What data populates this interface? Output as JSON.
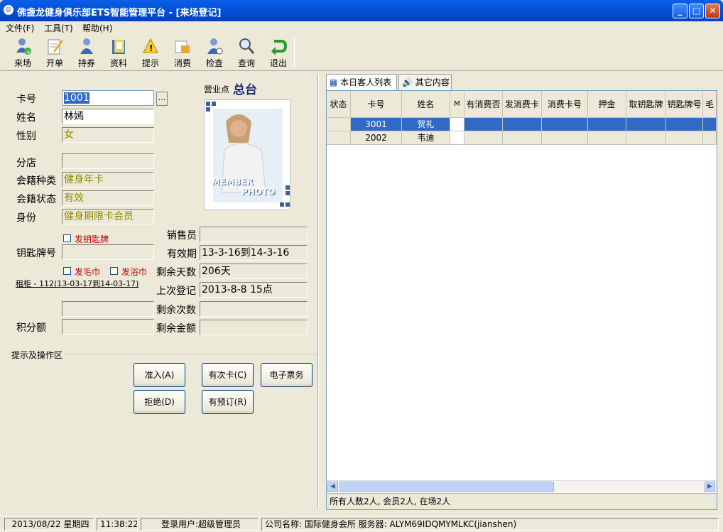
{
  "window": {
    "title": "佛盏龙健身俱乐部ETS智能管理平台 - [来场登记]"
  },
  "menu": [
    {
      "label": "文件(F)"
    },
    {
      "label": "工具(T)"
    },
    {
      "label": "帮助(H)"
    }
  ],
  "toolbar": [
    {
      "label": "来场",
      "icon": "user-add-icon"
    },
    {
      "label": "开单",
      "icon": "edit-icon"
    },
    {
      "label": "持券",
      "icon": "user-icon"
    },
    {
      "label": "资料",
      "icon": "book-icon"
    },
    {
      "label": "提示",
      "icon": "warning-icon"
    },
    {
      "label": "消费",
      "icon": "folder-icon"
    },
    {
      "label": "检查",
      "icon": "user-check-icon"
    },
    {
      "label": "查询",
      "icon": "search-icon"
    },
    {
      "label": "退出",
      "icon": "exit-icon"
    }
  ],
  "form": {
    "card_no_label": "卡号",
    "card_no": "1001",
    "browse": "...",
    "name_label": "姓名",
    "name": "林嫣",
    "gender_label": "性别",
    "gender": "女",
    "branch_label": "分店",
    "branch": "",
    "member_type_label": "会籍种类",
    "member_type": "健身年卡",
    "member_status_label": "会籍状态",
    "member_status": "有效",
    "identity_label": "身份",
    "identity": "健身期限卡会员",
    "key_issue_label": "发钥匙牌",
    "key_no_label": "钥匙牌号",
    "key_no": "",
    "towel_label": "发毛巾",
    "bath_towel_label": "发浴巾",
    "locker_link": "租柜 - 112(13-03-17到14-03-17)",
    "points_label": "积分额",
    "points": "",
    "blank_field": "",
    "sales_label": "销售员",
    "sales": "",
    "valid_label": "有效期",
    "valid": "13-3-16到14-3-16",
    "days_left_label": "剩余天数",
    "days_left": "206天",
    "last_visit_label": "上次登记",
    "last_visit": "2013-8-8 15点",
    "times_left_label": "剩余次数",
    "times_left": "",
    "amount_left_label": "剩余金额",
    "amount_left": ""
  },
  "business": {
    "label": "营业点",
    "value": "总台"
  },
  "photo": {
    "text1": "MEMBER",
    "text2": "PHOTO"
  },
  "ops": {
    "group_label": "提示及操作区",
    "allow": "准入(A)",
    "has_times": "有次卡(C)",
    "eticket": "电子票务",
    "refuse": "拒绝(D)",
    "reserved": "有预订(R)"
  },
  "tabs": [
    {
      "label": "本日客人列表"
    },
    {
      "label": "其它内容"
    }
  ],
  "table": {
    "columns": [
      "状态",
      "卡号",
      "姓名",
      "M",
      "有消费否",
      "发消费卡",
      "消费卡号",
      "押金",
      "取钥匙牌",
      "钥匙牌号",
      "毛"
    ],
    "rows": [
      [
        "",
        "3001",
        "贺礼",
        "",
        "",
        "",
        "",
        "",
        "",
        "",
        ""
      ],
      [
        "",
        "2002",
        "韦迪",
        "",
        "",
        "",
        "",
        "",
        "",
        "",
        ""
      ]
    ],
    "summary": "所有人数2人, 会员2人, 在场2人"
  },
  "status": {
    "date": "2013/08/22 星期四",
    "time": "11:38:22",
    "user": "登录用户:超级管理员",
    "company": "公司名称: 国际健身会所 服务器: ALYM69IDQMYMLKC(jianshen)"
  },
  "colors": {
    "titlebar": "#0351d8",
    "selection": "#316ac5",
    "field_text": "#8b8b00",
    "checkbox_label": "#c00000"
  }
}
